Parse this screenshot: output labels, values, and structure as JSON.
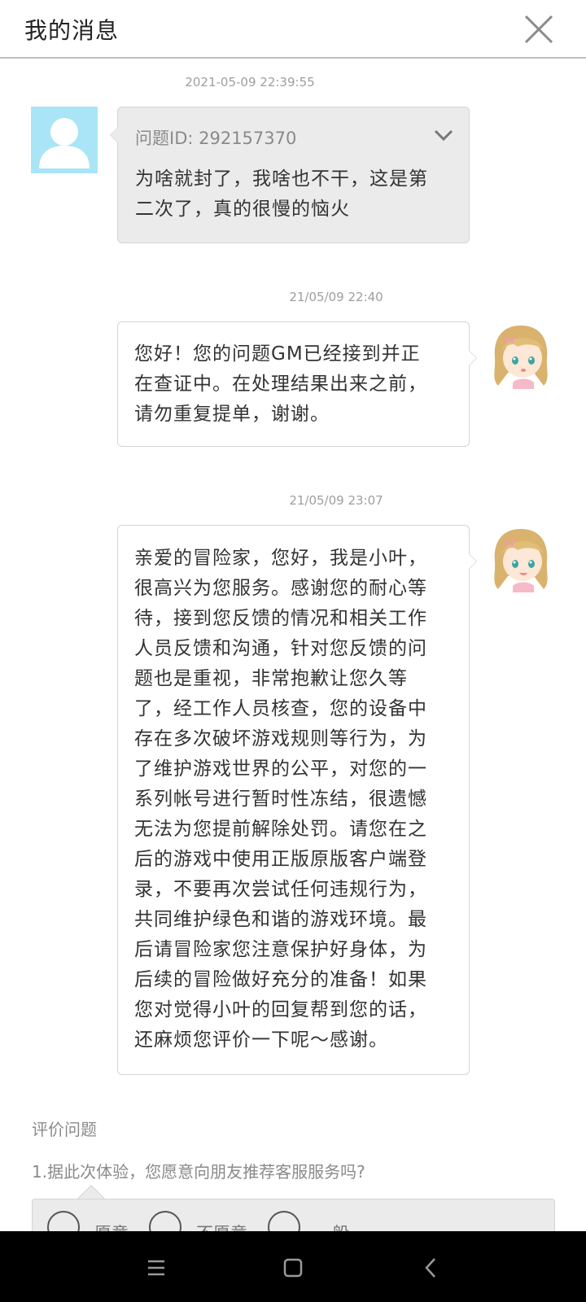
{
  "header": {
    "title": "我的消息"
  },
  "messages": [
    {
      "timestamp": "2021-05-09 22:39:55",
      "sender": "user",
      "ticket_id": "问题ID: 292157370",
      "text": "为啥就封了，我啥也不干，这是第\n二次了，真的很慢的恼火"
    },
    {
      "timestamp": "21/05/09 22:40",
      "sender": "gm",
      "text": "您好！您的问题GM已经接到并正\n在查证中。在处理结果出来之前，\n请勿重复提单，谢谢。"
    },
    {
      "timestamp": "21/05/09 23:07",
      "sender": "gm",
      "text": "亲爱的冒险家，您好，我是小叶，\n很高兴为您服务。感谢您的耐心等\n待，接到您反馈的情况和相关工作\n人员反馈和沟通，针对您反馈的问\n题也是重视，非常抱歉让您久等\n了，经工作人员核查，您的设备中\n存在多次破坏游戏规则等行为，为\n了维护游戏世界的公平，对您的一\n系列帐号进行暂时性冻结，很遗憾\n无法为您提前解除处罚。请您在之\n后的游戏中使用正版原版客户端登\n录，不要再次尝试任何违规行为，\n共同维护绿色和谐的游戏环境。最\n后请冒险家您注意保护好身体，为\n后续的冒险做好充分的准备！如果\n您对觉得小叶的回复帮到您的话，\n还麻烦您评价一下呢～感谢。"
    }
  ],
  "evaluation": {
    "title": "评价问题",
    "question": "1.据此次体验，您愿意向朋友推荐客服服务吗?",
    "options": [
      "愿意",
      "不愿意",
      "一般"
    ]
  },
  "icons": {
    "close": "close-icon",
    "expand": "chevron-down-icon",
    "nav_menu": "menu-icon",
    "nav_home": "home-square-icon",
    "nav_back": "back-chevron-icon"
  },
  "colors": {
    "user_avatar_bg": "#a9e4f7",
    "user_bubble_bg": "#ebebeb",
    "gm_bubble_bg": "#ffffff",
    "navbar_bg": "#000000"
  }
}
